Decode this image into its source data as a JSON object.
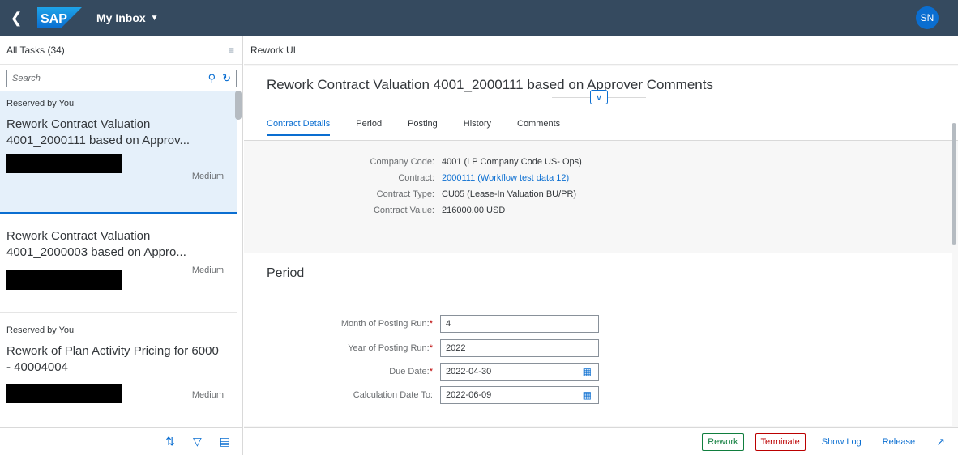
{
  "shell": {
    "back_icon": "chevron-left-icon",
    "logo": "SAP",
    "title": "My Inbox",
    "avatar_initials": "SN",
    "brand_color": "#354a5f"
  },
  "master": {
    "header": "All Tasks (34)",
    "search_placeholder": "Search",
    "items": [
      {
        "reserved": "Reserved by You",
        "title": "Rework Contract Valuation 4001_2000111 based on Approv...",
        "priority": "Medium",
        "selected": true
      },
      {
        "reserved": "",
        "title": "Rework Contract Valuation 4001_2000003 based on Appro...",
        "priority": "Medium",
        "selected": false
      },
      {
        "reserved": "Reserved by You",
        "title": "Rework of Plan Activity Pricing for 6000 - 40004004",
        "priority": "Medium",
        "selected": false
      }
    ]
  },
  "detail": {
    "header": "Rework UI",
    "object_title": "Rework Contract Valuation 4001_2000111 based on Approver Comments",
    "tabs": [
      "Contract Details",
      "Period",
      "Posting",
      "History",
      "Comments"
    ],
    "info": [
      {
        "label": "Company Code:",
        "value": "4001 (LP Company Code US- Ops)",
        "link": false
      },
      {
        "label": "Contract:",
        "value": "2000111 (Workflow test data 12)",
        "link": true
      },
      {
        "label": "Contract Type:",
        "value": "CU05 (Lease-In Valuation BU/PR)",
        "link": false
      },
      {
        "label": "Contract Value:",
        "value": "216000.00 USD",
        "link": false
      }
    ],
    "period": {
      "title": "Period",
      "fields": [
        {
          "label": "Month of Posting Run:",
          "required": true,
          "value": "4",
          "date": false
        },
        {
          "label": "Year of Posting Run:",
          "required": true,
          "value": "2022",
          "date": false
        },
        {
          "label": "Due Date:",
          "required": true,
          "value": "2022-04-30",
          "date": true
        },
        {
          "label": "Calculation Date To:",
          "required": false,
          "value": "2022-06-09",
          "date": true
        }
      ]
    },
    "footer": {
      "rework": "Rework",
      "terminate": "Terminate",
      "show_log": "Show Log",
      "release": "Release"
    }
  }
}
